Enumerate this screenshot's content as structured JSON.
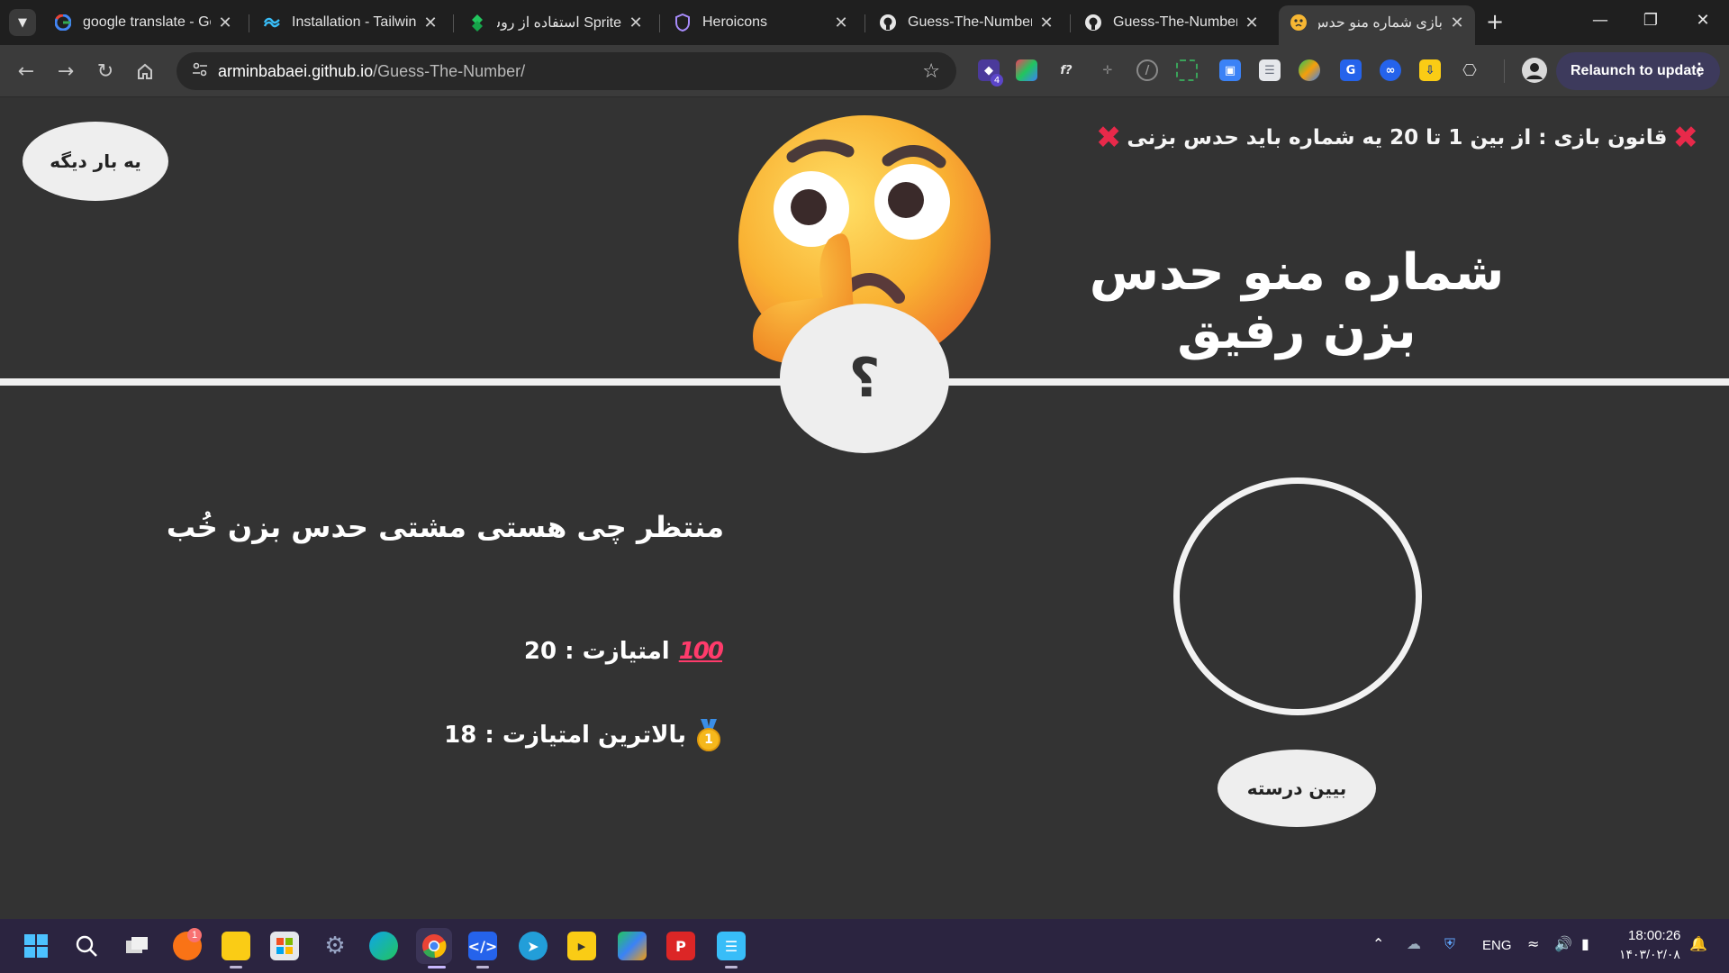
{
  "browser": {
    "tabs": [
      {
        "title": "google translate - Go",
        "icon": "google-icon"
      },
      {
        "title": "Installation - Tailwin",
        "icon": "tailwind-icon"
      },
      {
        "title": "Sprite استفاده از روش",
        "icon": "sprite-icon"
      },
      {
        "title": "Heroicons",
        "icon": "heroicons-icon"
      },
      {
        "title": "Guess-The-Number/",
        "icon": "github-icon"
      },
      {
        "title": "Guess-The-Number/",
        "icon": "github-icon"
      },
      {
        "title": "بازی شماره منو حدس",
        "icon": "thinking-emoji-icon",
        "active": true
      }
    ],
    "address": {
      "host": "arminbabaei.github.io",
      "path": "/Guess-The-Number/"
    },
    "extension_badge": "4",
    "relaunch_label": "Relaunch to update"
  },
  "game": {
    "again_label": "یه بار دیگه",
    "rule_text": "قانون بازی : از بین 1 تا 20 یه شماره باید حدس بزنی",
    "title": "شماره منو حدس بزن رفیق",
    "secret_symbol": "؟",
    "check_label": "بیین درسته",
    "message": "منتظر چی هستی مشتی حدس بزن خُب",
    "score_label": "امتیازت : 20",
    "score_badge": "100",
    "highscore_label": "بالاترین امتیازت : 18",
    "medal_number": "1",
    "colors": {
      "background": "#333333",
      "accent_x": "#e8294a",
      "light": "#eeeeee"
    }
  },
  "taskbar": {
    "store_badge": "1",
    "language": "ENG",
    "time": "18:00:26",
    "date": "۱۴۰۳/۰۲/۰۸"
  }
}
